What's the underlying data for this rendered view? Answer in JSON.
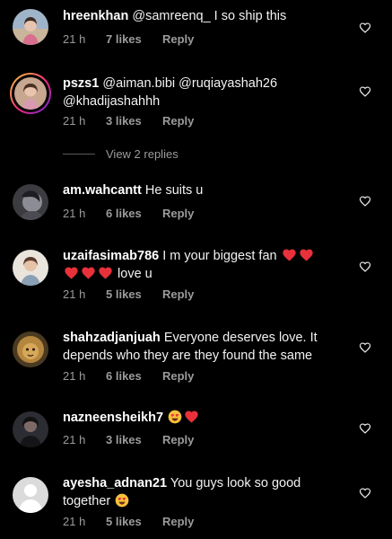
{
  "reply_link_label": "Reply",
  "view_replies_label": "View 2 replies",
  "comments": [
    {
      "username": "hreenkhan",
      "text_parts": [
        "@samreenq_ I so ship this"
      ],
      "time": "21 h",
      "likes": "7 likes"
    },
    {
      "username": "pszs1",
      "text_parts": [
        "@aiman.bibi @ruqiayashah26 @khadijashahhh"
      ],
      "time": "21 h",
      "likes": "3 likes"
    },
    {
      "username": "am.wahcantt",
      "text_parts": [
        "He suits u"
      ],
      "time": "21 h",
      "likes": "6 likes"
    },
    {
      "username": "uzaifasimab786",
      "text_parts": [
        "I m your biggest fan",
        "love u"
      ],
      "time": "21 h",
      "likes": "5 likes"
    },
    {
      "username": "shahzadjanjuah",
      "text_parts": [
        "Everyone deserves love. It depends who they are they found the same"
      ],
      "time": "21 h",
      "likes": "6 likes"
    },
    {
      "username": "nazneensheikh7",
      "text_parts": [
        ""
      ],
      "time": "21 h",
      "likes": "3 likes"
    },
    {
      "username": "ayesha_adnan21",
      "text_parts": [
        "You guys look so good together"
      ],
      "time": "21 h",
      "likes": "5 likes"
    }
  ],
  "icons": {
    "like": "heart-outline-icon",
    "emoji_heart": "red-heart-emoji",
    "emoji_face": "heart-eyes-emoji"
  },
  "colors": {
    "background": "#000000",
    "secondary_text": "#9b9b9b",
    "emoji_red": "#e8313a"
  }
}
